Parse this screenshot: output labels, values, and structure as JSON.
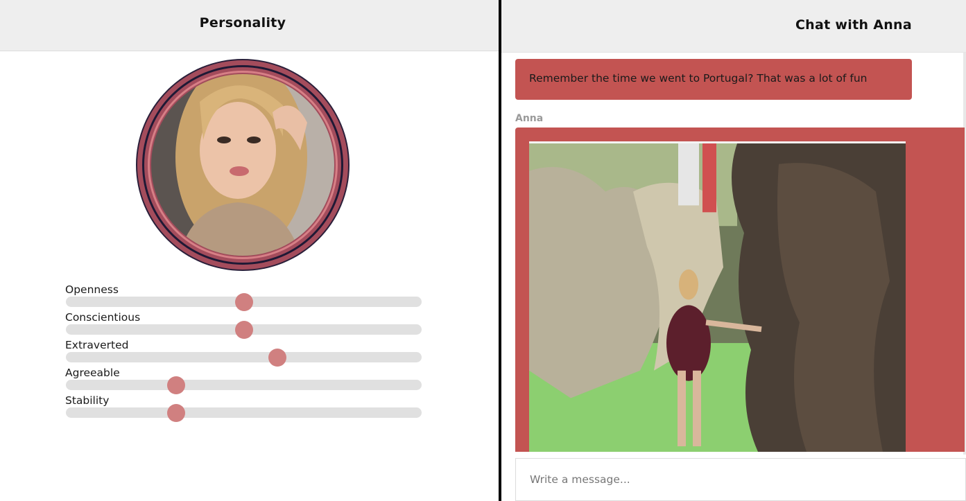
{
  "personality_panel": {
    "title": "Personality",
    "avatar_alt": "profile photo",
    "traits": [
      {
        "label": "Openness",
        "value": 0.5
      },
      {
        "label": "Conscientious",
        "value": 0.5
      },
      {
        "label": "Extraverted",
        "value": 0.595
      },
      {
        "label": "Agreeable",
        "value": 0.31
      },
      {
        "label": "Stability",
        "value": 0.31
      }
    ],
    "colors": {
      "thumb": "#d08080",
      "track": "#e0e0e0",
      "avatar_ring": "#a44c5c"
    }
  },
  "chat_panel": {
    "title": "Chat with Anna",
    "messages": [
      {
        "sender": "",
        "text": "Remember the time we went to Portugal? That was a lot of fun"
      },
      {
        "sender": "Anna",
        "type": "photo"
      }
    ],
    "composer": {
      "placeholder": "Write a message..."
    },
    "colors": {
      "bubble": "#c35452"
    }
  }
}
